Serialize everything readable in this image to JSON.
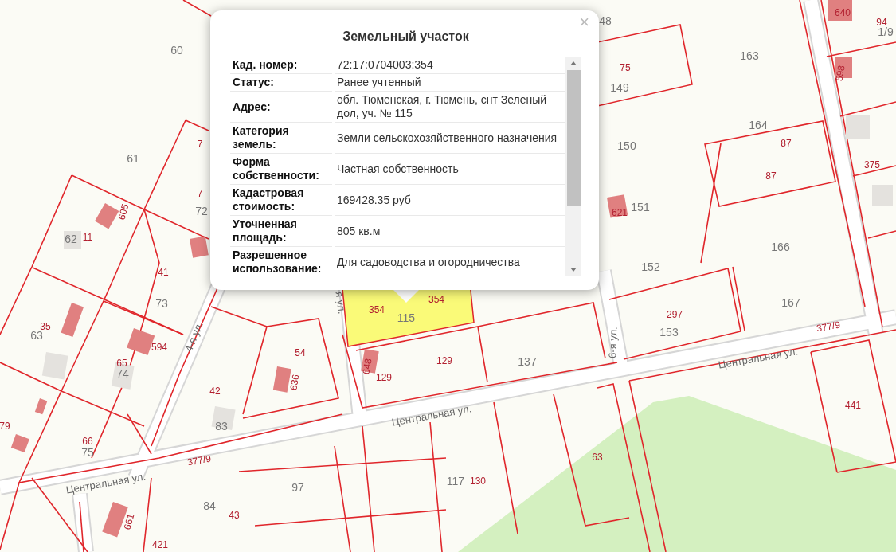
{
  "map": {
    "labels": [
      {
        "text": "60",
        "kind": "parcel"
      },
      {
        "text": "61",
        "kind": "parcel"
      },
      {
        "text": "72",
        "kind": "parcel"
      },
      {
        "text": "62",
        "kind": "parcel"
      },
      {
        "text": "73",
        "kind": "parcel"
      },
      {
        "text": "63",
        "kind": "parcel"
      },
      {
        "text": "74",
        "kind": "parcel"
      },
      {
        "text": "75",
        "kind": "parcel"
      },
      {
        "text": "83",
        "kind": "parcel"
      },
      {
        "text": "97",
        "kind": "parcel"
      },
      {
        "text": "84",
        "kind": "parcel"
      },
      {
        "text": "48",
        "kind": "parcel"
      },
      {
        "text": "149",
        "kind": "parcel"
      },
      {
        "text": "150",
        "kind": "parcel"
      },
      {
        "text": "151",
        "kind": "parcel"
      },
      {
        "text": "152",
        "kind": "parcel"
      },
      {
        "text": "153",
        "kind": "parcel"
      },
      {
        "text": "163",
        "kind": "parcel"
      },
      {
        "text": "164",
        "kind": "parcel"
      },
      {
        "text": "166",
        "kind": "parcel"
      },
      {
        "text": "167",
        "kind": "parcel"
      },
      {
        "text": "137",
        "kind": "parcel"
      },
      {
        "text": "115",
        "kind": "parcel"
      },
      {
        "text": "117",
        "kind": "parcel"
      },
      {
        "text": "1/9",
        "kind": "parcel"
      },
      {
        "text": "7",
        "kind": "number"
      },
      {
        "text": "7",
        "kind": "number"
      },
      {
        "text": "605",
        "kind": "number"
      },
      {
        "text": "11",
        "kind": "number"
      },
      {
        "text": "41",
        "kind": "number"
      },
      {
        "text": "35",
        "kind": "number"
      },
      {
        "text": "594",
        "kind": "number"
      },
      {
        "text": "65",
        "kind": "number"
      },
      {
        "text": "54",
        "kind": "number"
      },
      {
        "text": "636",
        "kind": "number"
      },
      {
        "text": "42",
        "kind": "number"
      },
      {
        "text": "66",
        "kind": "number"
      },
      {
        "text": "79",
        "kind": "number"
      },
      {
        "text": "377/9",
        "kind": "number"
      },
      {
        "text": "43",
        "kind": "number"
      },
      {
        "text": "421",
        "kind": "number"
      },
      {
        "text": "661",
        "kind": "number"
      },
      {
        "text": "354",
        "kind": "number"
      },
      {
        "text": "354",
        "kind": "number"
      },
      {
        "text": "648",
        "kind": "number"
      },
      {
        "text": "129",
        "kind": "number"
      },
      {
        "text": "129",
        "kind": "number"
      },
      {
        "text": "130",
        "kind": "number"
      },
      {
        "text": "63",
        "kind": "number"
      },
      {
        "text": "75",
        "kind": "number"
      },
      {
        "text": "621",
        "kind": "number"
      },
      {
        "text": "87",
        "kind": "number"
      },
      {
        "text": "87",
        "kind": "number"
      },
      {
        "text": "297",
        "kind": "number"
      },
      {
        "text": "377/9",
        "kind": "number"
      },
      {
        "text": "441",
        "kind": "number"
      },
      {
        "text": "640",
        "kind": "number"
      },
      {
        "text": "94",
        "kind": "number"
      },
      {
        "text": "598",
        "kind": "number"
      },
      {
        "text": "375",
        "kind": "number"
      },
      {
        "text": "Центральная ул.",
        "kind": "street"
      },
      {
        "text": "Центральная ул.",
        "kind": "street"
      },
      {
        "text": "Центральная ул.",
        "kind": "street"
      },
      {
        "text": "4-я ул.",
        "kind": "street"
      },
      {
        "text": "-я ул.",
        "kind": "street"
      },
      {
        "text": "6-я ул.",
        "kind": "street"
      }
    ]
  },
  "popup": {
    "title": "Земельный участок",
    "close": "×",
    "fields": [
      {
        "label": "Кад. номер:",
        "value": "72:17:0704003:354"
      },
      {
        "label": "Статус:",
        "value": "Ранее учтенный"
      },
      {
        "label": "Адрес:",
        "value": "обл. Тюменская, г. Тюмень, снт Зеленый дол, уч. № 115"
      },
      {
        "label": "Категория земель:",
        "value": "Земли сельскохозяйственного назначения"
      },
      {
        "label": "Форма собственности:",
        "value": "Частная собственность"
      },
      {
        "label": "Кадастровая стоимость:",
        "value": "169428.35 руб"
      },
      {
        "label": "Уточненная площадь:",
        "value": "805 кв.м"
      },
      {
        "label": "Разрешенное использование:",
        "value": "Для садоводства и огородничества"
      }
    ]
  }
}
